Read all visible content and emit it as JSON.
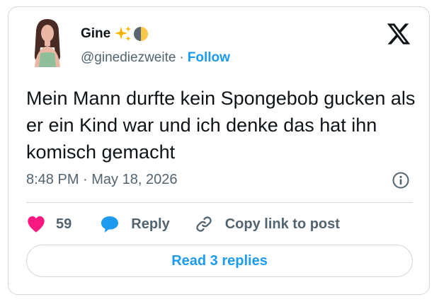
{
  "author": {
    "display_name": "Gine",
    "handle": "@ginediezweite",
    "separator": "·",
    "follow_label": "Follow",
    "name_emojis": [
      "sparkles-icon",
      "last-quarter-moon-icon"
    ]
  },
  "tweet": {
    "text": "Mein Mann durfte kein Spongebob gucken als er ein Kind war und ich denke das hat ihn komisch gemacht",
    "timestamp": "8:48 PM · May 18, 2026"
  },
  "actions": {
    "like_count": "59",
    "reply_label": "Reply",
    "copy_label": "Copy link to post"
  },
  "replies_button": "Read 3 replies",
  "colors": {
    "accent": "#1d9bf0",
    "like": "#f91880",
    "text": "#0f1419",
    "secondary": "#536471",
    "border": "#cfd9de"
  }
}
